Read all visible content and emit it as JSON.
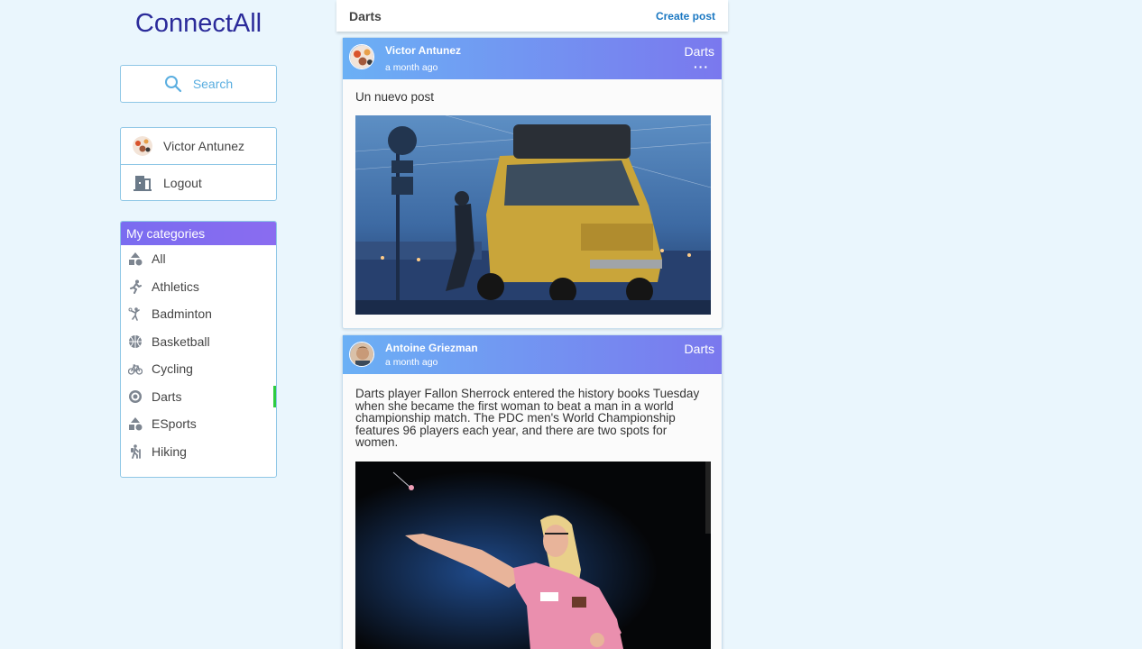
{
  "app": {
    "brand": "ConnectAll"
  },
  "sidebar": {
    "search_label": "Search",
    "user_name": "Victor Antunez",
    "logout_label": "Logout",
    "categories_title": "My categories",
    "categories": [
      {
        "label": "All",
        "icon": "shapes-icon"
      },
      {
        "label": "Athletics",
        "icon": "running-icon"
      },
      {
        "label": "Badminton",
        "icon": "badminton-icon"
      },
      {
        "label": "Basketball",
        "icon": "basketball-icon"
      },
      {
        "label": "Cycling",
        "icon": "bicycle-icon"
      },
      {
        "label": "Darts",
        "icon": "target-icon",
        "active": true
      },
      {
        "label": "ESports",
        "icon": "shapes-icon"
      },
      {
        "label": "Hiking",
        "icon": "hiking-icon"
      }
    ]
  },
  "feed": {
    "title": "Darts",
    "create_label": "Create post",
    "posts": [
      {
        "author": "Victor Antunez",
        "time": "a month ago",
        "category": "Darts",
        "menu": "···",
        "text": "Un nuevo post"
      },
      {
        "author": "Antoine Griezman",
        "time": "a month ago",
        "category": "Darts",
        "text": "Darts player Fallon Sherrock entered the history books Tuesday when she became the first woman to beat a man in a world championship match. The PDC men's World Championship features 96 players each year, and there are two spots for women."
      }
    ]
  },
  "colors": {
    "accent": "#7a6cf0",
    "brand": "#2b2b9a",
    "link": "#1b78c2",
    "active_marker": "#2ecc40"
  }
}
